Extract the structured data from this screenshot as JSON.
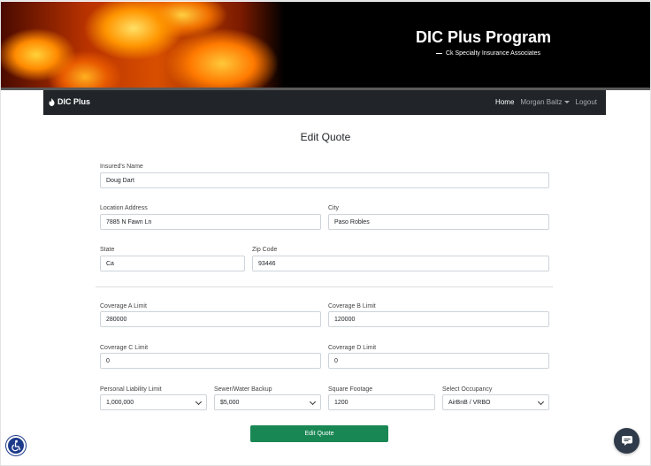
{
  "banner": {
    "title": "DIC Plus Program",
    "subtitle": "Ck Specialty Insurance Associates"
  },
  "navbar": {
    "brand": "DIC Plus",
    "home": "Home",
    "user": "Morgan Baitz",
    "logout": "Logout"
  },
  "form": {
    "title": "Edit Quote",
    "insured_name": {
      "label": "Insured's Name",
      "value": "Doug Dart"
    },
    "location_address": {
      "label": "Location Address",
      "value": "7885 N Fawn Ln"
    },
    "city": {
      "label": "City",
      "value": "Paso Robles"
    },
    "state": {
      "label": "State",
      "value": "Ca"
    },
    "zip": {
      "label": "Zip Code",
      "value": "93446"
    },
    "coverage_a": {
      "label": "Coverage A Limit",
      "value": "280000"
    },
    "coverage_b": {
      "label": "Coverage B Limit",
      "value": "120000"
    },
    "coverage_c": {
      "label": "Coverage C Limit",
      "value": "0"
    },
    "coverage_d": {
      "label": "Coverage D Limit",
      "value": "0"
    },
    "personal_liability": {
      "label": "Personal Liability Limit",
      "value": "1,000,000"
    },
    "sewer_backup": {
      "label": "Sewer/Water Backup",
      "value": "$5,000"
    },
    "square_footage": {
      "label": "Square Footage",
      "value": "1200"
    },
    "occupancy": {
      "label": "Select Occupancy",
      "value": "AirBnB / VRBO"
    },
    "submit_label": "Edit Quote"
  },
  "colors": {
    "navbar": "#212529",
    "submit": "#198754",
    "accessibility": "#1d3a8a",
    "chat": "#2f3b4a"
  },
  "icons": {
    "brand": "fire-icon",
    "accessibility": "accessibility-icon",
    "chat": "chat-icon"
  }
}
